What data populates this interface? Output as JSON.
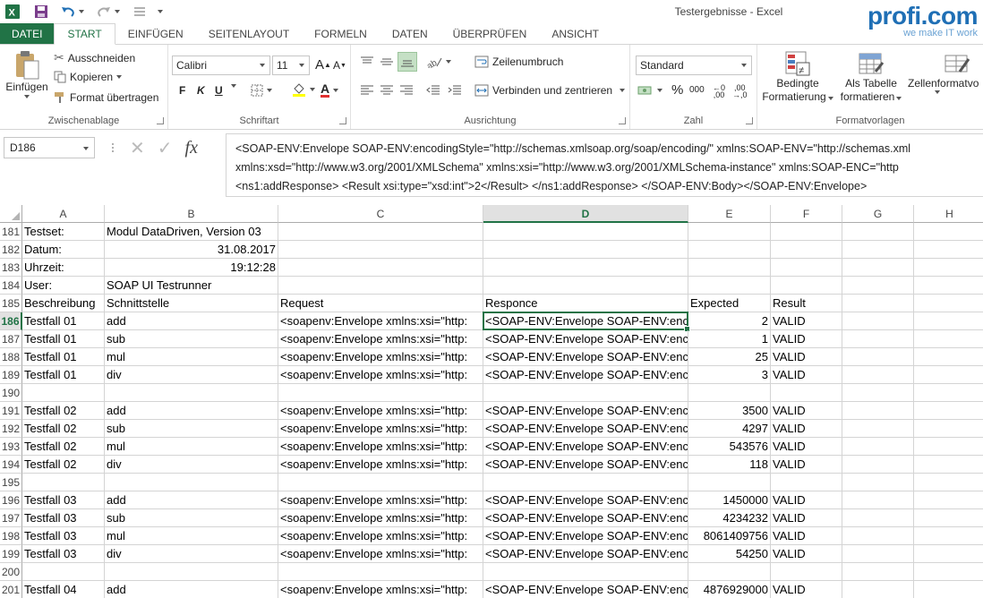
{
  "window": {
    "title": "Testergebnisse - Excel"
  },
  "brand": {
    "name": "profi.com",
    "tagline": "we make IT work"
  },
  "tabs": [
    "DATEI",
    "START",
    "EINFÜGEN",
    "SEITENLAYOUT",
    "FORMELN",
    "DATEN",
    "ÜBERPRÜFEN",
    "ANSICHT"
  ],
  "active_tab": "START",
  "ribbon": {
    "clipboard": {
      "paste": "Einfügen",
      "cut": "Ausschneiden",
      "copy": "Kopieren",
      "format_painter": "Format übertragen",
      "label": "Zwischenablage"
    },
    "font": {
      "name": "Calibri",
      "size": "11",
      "bold": "F",
      "italic": "K",
      "underline": "U",
      "fill_letter": "A",
      "label": "Schriftart"
    },
    "alignment": {
      "wrap": "Zeilenumbruch",
      "merge": "Verbinden und zentrieren",
      "label": "Ausrichtung"
    },
    "number": {
      "format": "Standard",
      "percent": "%",
      "thousands": "000",
      "label": "Zahl"
    },
    "styles": {
      "conditional_1": "Bedingte",
      "conditional_2": "Formatierung",
      "table_1": "Als Tabelle",
      "table_2": "formatieren",
      "cell_styles": "Zellenformatvo",
      "label": "Formatvorlagen"
    }
  },
  "formula_bar": {
    "name_box": "D186",
    "fx": "fx",
    "line1": "<SOAP-ENV:Envelope SOAP-ENV:encodingStyle=\"http://schemas.xmlsoap.org/soap/encoding/\" xmlns:SOAP-ENV=\"http://schemas.xml",
    "line2": "xmlns:xsd=\"http://www.w3.org/2001/XMLSchema\" xmlns:xsi=\"http://www.w3.org/2001/XMLSchema-instance\" xmlns:SOAP-ENC=\"http",
    "line3": "<ns1:addResponse>      <Result xsi:type=\"xsd:int\">2</Result>      </ns1:addResponse>  </SOAP-ENV:Body></SOAP-ENV:Envelope>"
  },
  "columns": [
    "A",
    "B",
    "C",
    "D",
    "E",
    "F",
    "G",
    "H"
  ],
  "selected_cell": {
    "col": "D",
    "row": "186"
  },
  "rows": [
    {
      "num": "181",
      "cells": [
        "Testset:",
        "Modul DataDriven, Version 03",
        "",
        "",
        "",
        ""
      ]
    },
    {
      "num": "182",
      "cells": [
        "Datum:",
        "31.08.2017",
        "",
        "",
        "",
        ""
      ]
    },
    {
      "num": "183",
      "cells": [
        "Uhrzeit:",
        "19:12:28",
        "",
        "",
        "",
        ""
      ]
    },
    {
      "num": "184",
      "cells": [
        "User:",
        "SOAP UI Testrunner",
        "",
        "",
        "",
        ""
      ]
    },
    {
      "num": "185",
      "cells": [
        "Beschreibung",
        "Schnittstelle",
        "Request",
        "Responce",
        "Expected",
        "Result"
      ]
    },
    {
      "num": "186",
      "cells": [
        "Testfall  01",
        "add",
        "<soapenv:Envelope xmlns:xsi=\"http:",
        "<SOAP-ENV:Envelope SOAP-ENV:enc",
        "2",
        "VALID"
      ]
    },
    {
      "num": "187",
      "cells": [
        "Testfall  01",
        "sub",
        "<soapenv:Envelope xmlns:xsi=\"http:",
        "<SOAP-ENV:Envelope SOAP-ENV:enc",
        "1",
        "VALID"
      ]
    },
    {
      "num": "188",
      "cells": [
        "Testfall  01",
        "mul",
        "<soapenv:Envelope xmlns:xsi=\"http:",
        "<SOAP-ENV:Envelope SOAP-ENV:enc",
        "25",
        "VALID"
      ]
    },
    {
      "num": "189",
      "cells": [
        "Testfall  01",
        "div",
        "<soapenv:Envelope xmlns:xsi=\"http:",
        "<SOAP-ENV:Envelope SOAP-ENV:enc",
        "3",
        "VALID"
      ]
    },
    {
      "num": "190",
      "cells": [
        "",
        "",
        "",
        "",
        "",
        ""
      ]
    },
    {
      "num": "191",
      "cells": [
        "Testfall  02",
        "add",
        "<soapenv:Envelope xmlns:xsi=\"http:",
        "<SOAP-ENV:Envelope SOAP-ENV:enc",
        "3500",
        "VALID"
      ]
    },
    {
      "num": "192",
      "cells": [
        "Testfall  02",
        "sub",
        "<soapenv:Envelope xmlns:xsi=\"http:",
        "<SOAP-ENV:Envelope SOAP-ENV:enc",
        "4297",
        "VALID"
      ]
    },
    {
      "num": "193",
      "cells": [
        "Testfall  02",
        "mul",
        "<soapenv:Envelope xmlns:xsi=\"http:",
        "<SOAP-ENV:Envelope SOAP-ENV:enc",
        "543576",
        "VALID"
      ]
    },
    {
      "num": "194",
      "cells": [
        "Testfall  02",
        "div",
        "<soapenv:Envelope xmlns:xsi=\"http:",
        "<SOAP-ENV:Envelope SOAP-ENV:enc",
        "118",
        "VALID"
      ]
    },
    {
      "num": "195",
      "cells": [
        "",
        "",
        "",
        "",
        "",
        ""
      ]
    },
    {
      "num": "196",
      "cells": [
        "Testfall  03",
        "add",
        "<soapenv:Envelope xmlns:xsi=\"http:",
        "<SOAP-ENV:Envelope SOAP-ENV:enc",
        "1450000",
        "VALID"
      ]
    },
    {
      "num": "197",
      "cells": [
        "Testfall  03",
        "sub",
        "<soapenv:Envelope xmlns:xsi=\"http:",
        "<SOAP-ENV:Envelope SOAP-ENV:enc",
        "4234232",
        "VALID"
      ]
    },
    {
      "num": "198",
      "cells": [
        "Testfall  03",
        "mul",
        "<soapenv:Envelope xmlns:xsi=\"http:",
        "<SOAP-ENV:Envelope SOAP-ENV:enc",
        "8061409756",
        "VALID"
      ]
    },
    {
      "num": "199",
      "cells": [
        "Testfall  03",
        "div",
        "<soapenv:Envelope xmlns:xsi=\"http:",
        "<SOAP-ENV:Envelope SOAP-ENV:enc",
        "54250",
        "VALID"
      ]
    },
    {
      "num": "200",
      "cells": [
        "",
        "",
        "",
        "",
        "",
        ""
      ]
    },
    {
      "num": "201",
      "cells": [
        "Testfall  04",
        "add",
        "<soapenv:Envelope xmlns:xsi=\"http:",
        "<SOAP-ENV:Envelope SOAP-ENV:enc",
        "4876929000",
        "VALID"
      ]
    }
  ],
  "colors": {
    "excel_green": "#217346",
    "brand_blue": "#1f6fb5"
  }
}
